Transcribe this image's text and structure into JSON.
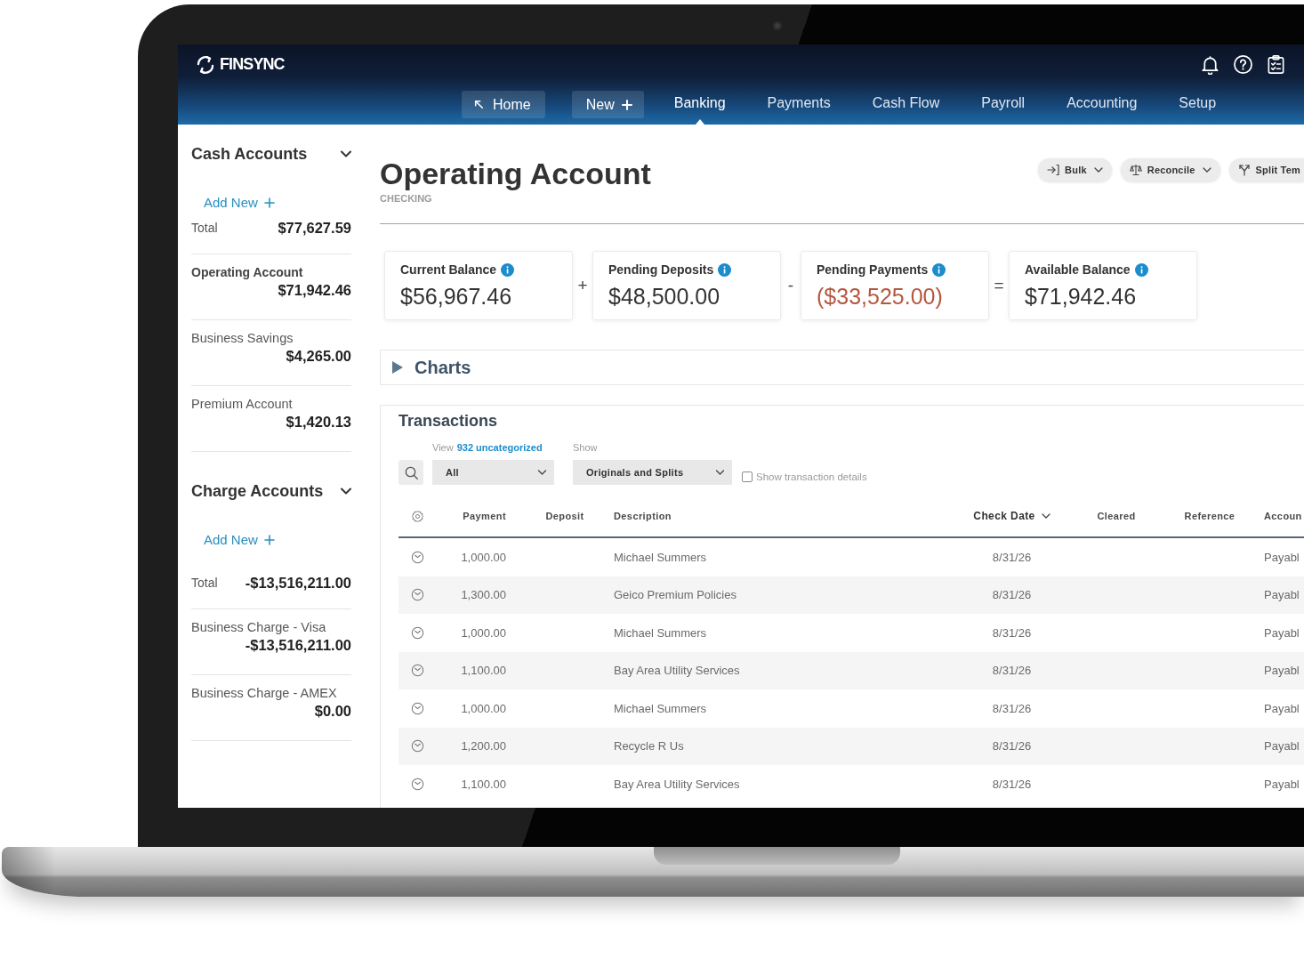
{
  "header": {
    "logo": "FINSYNC",
    "nav": [
      {
        "label": "Home",
        "kind": "back",
        "selected": false
      },
      {
        "label": "New",
        "kind": "create",
        "selected": false
      },
      {
        "label": "Banking",
        "kind": "tab",
        "selected": true
      },
      {
        "label": "Payments",
        "kind": "tab",
        "selected": false
      },
      {
        "label": "Cash Flow",
        "kind": "tab",
        "selected": false
      },
      {
        "label": "Payroll",
        "kind": "tab",
        "selected": false
      },
      {
        "label": "Accounting",
        "kind": "tab",
        "selected": false
      },
      {
        "label": "Setup",
        "kind": "tab",
        "selected": false
      }
    ]
  },
  "sidebar": {
    "sections": [
      {
        "title": "Cash Accounts",
        "expanded": true,
        "add_new": "Add New",
        "total_label": "Total",
        "total": "$77,627.59",
        "accounts": [
          {
            "name": "Operating Account",
            "balance": "$71,942.46",
            "selected": true
          },
          {
            "name": "Business Savings",
            "balance": "$4,265.00",
            "selected": false
          },
          {
            "name": "Premium Account",
            "balance": "$1,420.13",
            "selected": false
          }
        ]
      },
      {
        "title": "Charge Accounts",
        "expanded": true,
        "add_new": "Add New",
        "total_label": "Total",
        "total": "-$13,516,211.00",
        "accounts": [
          {
            "name": "Business Charge - Visa",
            "balance": "-$13,516,211.00",
            "selected": false
          },
          {
            "name": "Business Charge - AMEX",
            "balance": "$0.00",
            "selected": false
          }
        ]
      }
    ]
  },
  "account": {
    "title": "Operating Account",
    "type": "CHECKING",
    "actions": [
      {
        "label": "Bulk",
        "kind": "bulk",
        "dropdown": true
      },
      {
        "label": "Reconcile",
        "kind": "reconcile",
        "dropdown": true
      },
      {
        "label": "Split Tem",
        "kind": "split",
        "dropdown": false
      }
    ]
  },
  "balances": [
    {
      "kind": "card",
      "label": "Current Balance",
      "value": "$56,967.46",
      "negative": false
    },
    {
      "kind": "operator",
      "symbol": "+"
    },
    {
      "kind": "card",
      "label": "Pending Deposits",
      "value": "$48,500.00",
      "negative": false
    },
    {
      "kind": "operator",
      "symbol": "-"
    },
    {
      "kind": "card",
      "label": "Pending Payments",
      "value": "($33,525.00)",
      "negative": true
    },
    {
      "kind": "operator",
      "symbol": "="
    },
    {
      "kind": "card",
      "label": "Available Balance",
      "value": "$71,942.46",
      "negative": false
    }
  ],
  "charts": {
    "title": "Charts",
    "expanded": false
  },
  "transactions": {
    "title": "Transactions",
    "view_label": "View",
    "uncategorized_link": "932 uncategorized",
    "status_filter": "All",
    "show_label": "Show",
    "show_filter": "Originals and Splits",
    "details_toggle": {
      "label": "Show transaction details",
      "checked": false
    },
    "columns": [
      {
        "label": "Payment",
        "sorted": false
      },
      {
        "label": "Deposit",
        "sorted": false
      },
      {
        "label": "Description",
        "sorted": false
      },
      {
        "label": "Check Date",
        "sorted": true
      },
      {
        "label": "Cleared",
        "sorted": false
      },
      {
        "label": "Reference",
        "sorted": false
      },
      {
        "label": "Accoun",
        "sorted": false
      }
    ],
    "rows": [
      {
        "payment": "1,000.00",
        "description": "Michael Summers",
        "check_date": "8/31/26",
        "account": "Payabl"
      },
      {
        "payment": "1,300.00",
        "description": "Geico Premium Policies",
        "check_date": "8/31/26",
        "account": "Payabl"
      },
      {
        "payment": "1,000.00",
        "description": "Michael Summers",
        "check_date": "8/31/26",
        "account": "Payabl"
      },
      {
        "payment": "1,100.00",
        "description": "Bay Area Utility Services",
        "check_date": "8/31/26",
        "account": "Payabl"
      },
      {
        "payment": "1,000.00",
        "description": "Michael Summers",
        "check_date": "8/31/26",
        "account": "Payabl"
      },
      {
        "payment": "1,200.00",
        "description": "Recycle R Us",
        "check_date": "8/31/26",
        "account": "Payabl"
      },
      {
        "payment": "1,100.00",
        "description": "Bay Area Utility Services",
        "check_date": "8/31/26",
        "account": "Payabl"
      }
    ]
  }
}
